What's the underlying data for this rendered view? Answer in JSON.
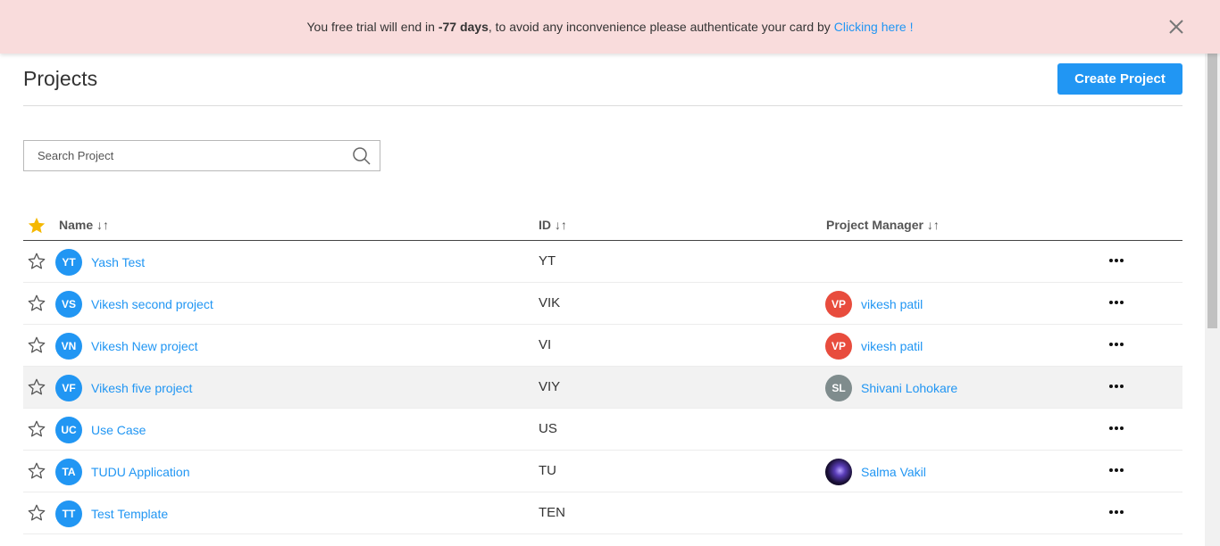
{
  "banner": {
    "text_before": "You free trial will end in ",
    "days": "-77 days",
    "text_after": ", to avoid any inconvenience please authenticate your card by",
    "link": "Clicking here !"
  },
  "page": {
    "title": "Projects",
    "create_label": "Create Project"
  },
  "search": {
    "placeholder": "Search Project"
  },
  "table": {
    "columns": {
      "name": "Name ↓↑",
      "id": "ID ↓↑",
      "manager": "Project Manager ↓↑"
    },
    "rows": [
      {
        "initials": "YT",
        "name": "Yash Test",
        "id": "YT",
        "manager": "",
        "manager_initials": "",
        "manager_color": ""
      },
      {
        "initials": "VS",
        "name": "Vikesh second project",
        "id": "VIK",
        "manager": "vikesh patil",
        "manager_initials": "VP",
        "manager_color": "#e84c3d"
      },
      {
        "initials": "VN",
        "name": "Vikesh New project",
        "id": "VI",
        "manager": "vikesh patil",
        "manager_initials": "VP",
        "manager_color": "#e84c3d"
      },
      {
        "initials": "VF",
        "name": "Vikesh five project",
        "id": "VIY",
        "manager": "Shivani Lohokare",
        "manager_initials": "SL",
        "manager_color": "#7f8c8d"
      },
      {
        "initials": "UC",
        "name": "Use Case",
        "id": "US",
        "manager": "",
        "manager_initials": "",
        "manager_color": ""
      },
      {
        "initials": "TA",
        "name": "TUDU Application",
        "id": "TU",
        "manager": "Salma Vakil",
        "manager_initials": "",
        "manager_color": "photo"
      },
      {
        "initials": "TT",
        "name": "Test Template",
        "id": "TEN",
        "manager": "",
        "manager_initials": "",
        "manager_color": ""
      }
    ]
  },
  "colors": {
    "accent": "#2196f3",
    "banner_bg": "#f9dcdc",
    "star_active": "#f5b800"
  }
}
